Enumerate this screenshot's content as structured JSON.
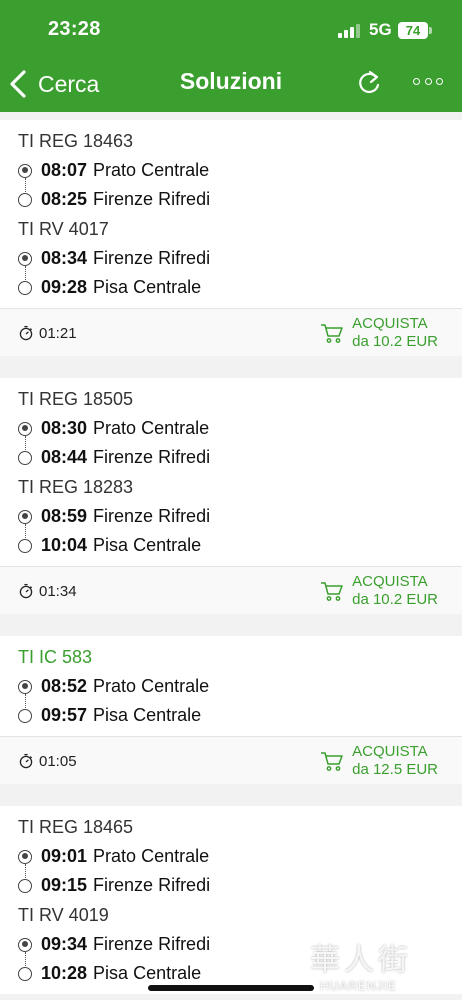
{
  "status_bar": {
    "time": "23:28",
    "network": "5G",
    "battery": "74"
  },
  "nav": {
    "back_label": "Cerca",
    "title": "Soluzioni"
  },
  "solutions": [
    {
      "legs": [
        {
          "train": "TI REG 18463",
          "highlight": false,
          "stops": [
            {
              "time": "08:07",
              "station": "Prato Centrale"
            },
            {
              "time": "08:25",
              "station": "Firenze Rifredi"
            }
          ]
        },
        {
          "train": "TI RV 4017",
          "highlight": false,
          "stops": [
            {
              "time": "08:34",
              "station": "Firenze Rifredi"
            },
            {
              "time": "09:28",
              "station": "Pisa Centrale"
            }
          ]
        }
      ],
      "duration": "01:21",
      "buy_label": "ACQUISTA",
      "price": "da 10.2 EUR"
    },
    {
      "legs": [
        {
          "train": "TI REG 18505",
          "highlight": false,
          "stops": [
            {
              "time": "08:30",
              "station": "Prato Centrale"
            },
            {
              "time": "08:44",
              "station": "Firenze Rifredi"
            }
          ]
        },
        {
          "train": "TI REG 18283",
          "highlight": false,
          "stops": [
            {
              "time": "08:59",
              "station": "Firenze Rifredi"
            },
            {
              "time": "10:04",
              "station": "Pisa Centrale"
            }
          ]
        }
      ],
      "duration": "01:34",
      "buy_label": "ACQUISTA",
      "price": "da 10.2 EUR"
    },
    {
      "legs": [
        {
          "train": "TI IC 583",
          "highlight": true,
          "stops": [
            {
              "time": "08:52",
              "station": "Prato Centrale"
            },
            {
              "time": "09:57",
              "station": "Pisa Centrale"
            }
          ]
        }
      ],
      "duration": "01:05",
      "buy_label": "ACQUISTA",
      "price": "da 12.5 EUR"
    },
    {
      "legs": [
        {
          "train": "TI REG 18465",
          "highlight": false,
          "stops": [
            {
              "time": "09:01",
              "station": "Prato Centrale"
            },
            {
              "time": "09:15",
              "station": "Firenze Rifredi"
            }
          ]
        },
        {
          "train": "TI RV 4019",
          "highlight": false,
          "stops": [
            {
              "time": "09:34",
              "station": "Firenze Rifredi"
            },
            {
              "time": "10:28",
              "station": "Pisa Centrale"
            }
          ]
        }
      ]
    }
  ],
  "watermark": {
    "main": "華人街",
    "sub": "HUARENJIE"
  },
  "colors": {
    "brand_green": "#3a9f2e",
    "text": "#111111",
    "background": "#f2f2f2"
  }
}
